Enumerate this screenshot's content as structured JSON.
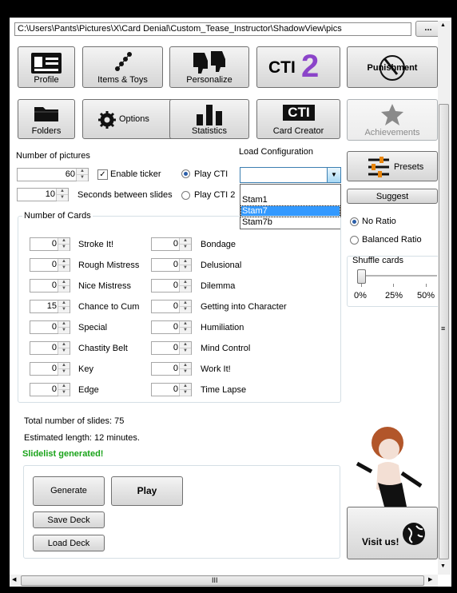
{
  "path": {
    "value": "C:\\Users\\Pants\\Pictures\\X\\Card Denial\\Custom_Tease_Instructor\\ShadowView\\pics",
    "browse_label": "..."
  },
  "toolbar1": {
    "profile": "Profile",
    "items": "Items & Toys",
    "personalize": "Personalize",
    "cti2_text": "CTI",
    "cti2_num": "2",
    "punishment": "Punishment"
  },
  "toolbar2": {
    "folders": "Folders",
    "options": "Options",
    "statistics": "Statistics",
    "cti_logo": "CTI",
    "card_creator": "Card Creator",
    "achievements": "Achievements"
  },
  "settings": {
    "num_pictures_label": "Number of pictures",
    "num_pictures_value": "60",
    "enable_ticker_label": "Enable ticker",
    "seconds_value": "10",
    "seconds_label": "Seconds between slides",
    "load_config_label": "Load Configuration",
    "play_cti_label": "Play CTI",
    "play_cti2_label": "Play CTI 2",
    "config_options": [
      "Stam1",
      "Stam7",
      "Stam7b"
    ],
    "config_selected": "Stam7"
  },
  "right": {
    "presets_label": "Presets",
    "suggest_label": "Suggest",
    "no_ratio_label": "No Ratio",
    "balanced_ratio_label": "Balanced Ratio",
    "shuffle_label": "Shuffle cards",
    "ticks": [
      "0%",
      "25%",
      "50%"
    ],
    "shuffle_value": "0%"
  },
  "cards": {
    "group_label": "Number of Cards",
    "left": [
      {
        "value": "0",
        "label": "Stroke It!"
      },
      {
        "value": "0",
        "label": "Rough Mistress"
      },
      {
        "value": "0",
        "label": "Nice Mistress"
      },
      {
        "value": "15",
        "label": "Chance to Cum"
      },
      {
        "value": "0",
        "label": "Special"
      },
      {
        "value": "0",
        "label": "Chastity Belt"
      },
      {
        "value": "0",
        "label": "Key"
      },
      {
        "value": "0",
        "label": "Edge"
      }
    ],
    "right": [
      {
        "value": "0",
        "label": "Bondage"
      },
      {
        "value": "0",
        "label": "Delusional"
      },
      {
        "value": "0",
        "label": "Dilemma"
      },
      {
        "value": "0",
        "label": "Getting into Character"
      },
      {
        "value": "0",
        "label": "Humiliation"
      },
      {
        "value": "0",
        "label": "Mind Control"
      },
      {
        "value": "0",
        "label": "Work It!"
      },
      {
        "value": "0",
        "label": "Time Lapse"
      }
    ]
  },
  "summary": {
    "total_slides": "Total number of slides: 75",
    "est_length": "Estimated length: 12 minutes.",
    "status": "Slidelist generated!",
    "status_color": "#19a319"
  },
  "actions": {
    "generate": "Generate",
    "play": "Play",
    "save_deck": "Save Deck",
    "load_deck": "Load Deck",
    "visit_us": "Visit us!"
  },
  "scroll": {
    "h_grip": "III",
    "v_grip": "≡"
  }
}
